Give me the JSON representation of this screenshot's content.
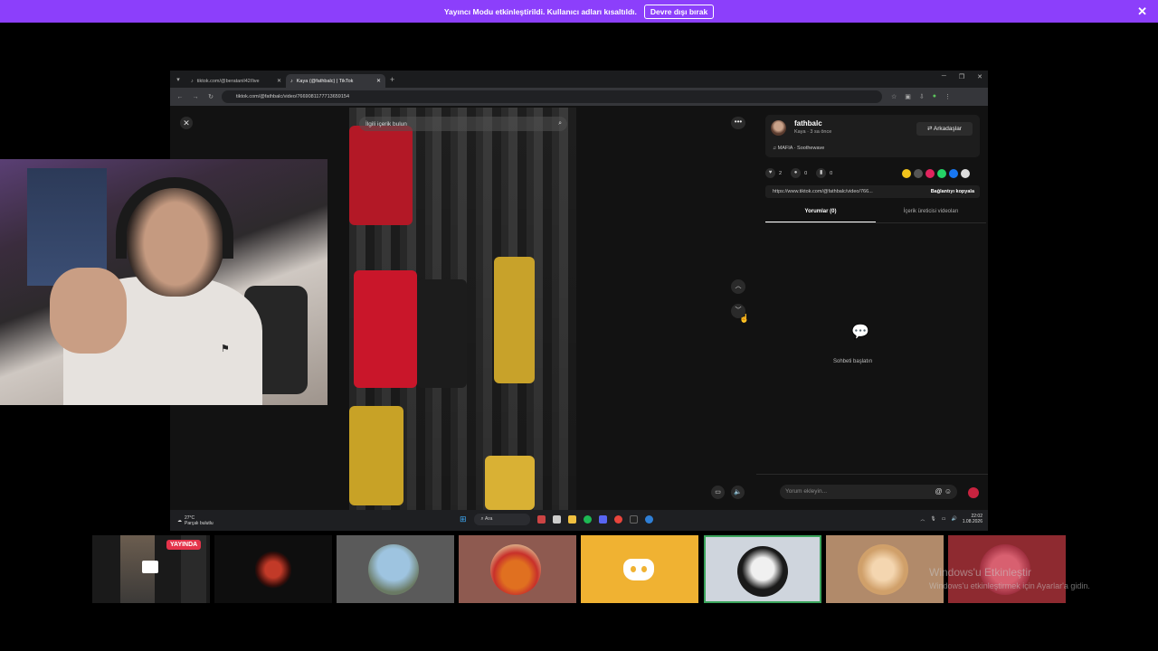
{
  "banner": {
    "message": "Yayıncı Modu etkinleştirildi. Kullanıcı adları kısaltıldı.",
    "button": "Devre dışı bırak",
    "close": "✕"
  },
  "browser": {
    "tabs": [
      {
        "label": "tiktok.com/@beratanil42/live",
        "active": false
      },
      {
        "label": "Kaya (@fathbalc) | TikTok",
        "active": true
      }
    ],
    "url": "tiktok.com/@fathbalc/video/7669081177713659154"
  },
  "tiktok": {
    "search_placeholder": "İlgili içerik bulun",
    "author": {
      "name": "fathbalc",
      "subtitle": "Kaya · 3 sa önce",
      "friends_button": "Arkadaşlar"
    },
    "music": "MAFIA · Soothewave",
    "stats": {
      "likes": "2",
      "comments": "0",
      "saves": "0"
    },
    "link": "https://www.tiktok.com/@fathbalc/video/766...",
    "copy_link": "Bağlantıyı kopyala",
    "tabs": [
      "Yorumlar (0)",
      "İçerik üreticisi videoları"
    ],
    "empty_text": "Sohbeti başlatın",
    "comment_placeholder": "Yorum ekleyin...",
    "share_colors": [
      "#f2c31b",
      "#555555",
      "#e0245e",
      "#25d366",
      "#1877f2",
      "#dddddd"
    ]
  },
  "taskbar": {
    "weather_temp": "27°C",
    "weather_desc": "Parçalı bulutlu",
    "search": "Ara",
    "time": "22:02",
    "date": "1.08.2026"
  },
  "stream_tiles": {
    "live_label": "YAYINDA",
    "tile_colors": [
      "#1a1a1a",
      "#0e0e0e",
      "#5a5a5a",
      "#8e5a50",
      "#f0b232",
      "#cfd5dd",
      "#b18a6a",
      "#8e2a30"
    ]
  },
  "watermark": {
    "title": "Windows'u Etkinleştir",
    "subtitle": "Windows'u etkinleştirmek için Ayarlar'a gidin."
  }
}
